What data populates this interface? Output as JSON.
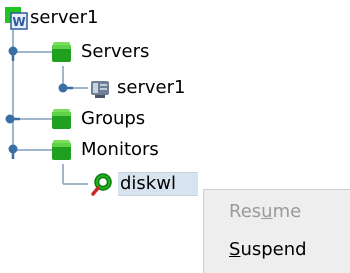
{
  "tree": {
    "root": {
      "label": "server1",
      "icon": "cluster-icon"
    },
    "servers_group": {
      "label": "Servers",
      "icon": "green-folder-icon"
    },
    "server_node": {
      "label": "server1",
      "icon": "server-icon"
    },
    "groups_group": {
      "label": "Groups",
      "icon": "green-folder-icon"
    },
    "monitors_group": {
      "label": "Monitors",
      "icon": "green-folder-icon"
    },
    "monitor_node": {
      "label": "diskwl",
      "icon": "monitor-magnifier-icon"
    }
  },
  "context_menu": {
    "resume": {
      "pre": "Res",
      "mnemonic": "u",
      "post": "me",
      "enabled": false
    },
    "suspend": {
      "pre": "",
      "mnemonic": "S",
      "post": "uspend",
      "enabled": true
    }
  },
  "colors": {
    "tree_line": "#9fb6cd",
    "handle": "#3a6ea5",
    "folder_green": "#1fa01f",
    "selection": "#d7e3ef",
    "menu_bg": "#eeeeee",
    "disabled_text": "#9a9a9a"
  }
}
